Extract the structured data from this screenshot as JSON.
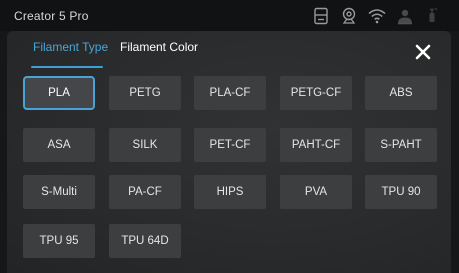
{
  "status_bar": {
    "title": "Creator 5 Pro",
    "icons": [
      "printer-icon",
      "camera-icon",
      "wifi-icon",
      "user-icon",
      "filament-spool-icon"
    ]
  },
  "tabs": [
    {
      "label": "Filament Type",
      "active": true
    },
    {
      "label": "Filament Color",
      "active": false
    }
  ],
  "close_icon": "close-icon",
  "colors": {
    "accent": "#4aa3d6",
    "button_bg": "#3d3e3f",
    "panel_bg": "#2c2d2e"
  },
  "filaments": [
    {
      "label": "PLA",
      "selected": true
    },
    {
      "label": "PETG"
    },
    {
      "label": "PLA-CF"
    },
    {
      "label": "PETG-CF"
    },
    {
      "label": "ABS"
    },
    {
      "label": "ASA"
    },
    {
      "label": "SILK"
    },
    {
      "label": "PET-CF"
    },
    {
      "label": "PAHT-CF"
    },
    {
      "label": "S-PAHT"
    },
    {
      "label": "S-Multi"
    },
    {
      "label": "PA-CF"
    },
    {
      "label": "HIPS"
    },
    {
      "label": "PVA"
    },
    {
      "label": "TPU 90"
    },
    {
      "label": "TPU 95"
    },
    {
      "label": "TPU 64D"
    }
  ]
}
